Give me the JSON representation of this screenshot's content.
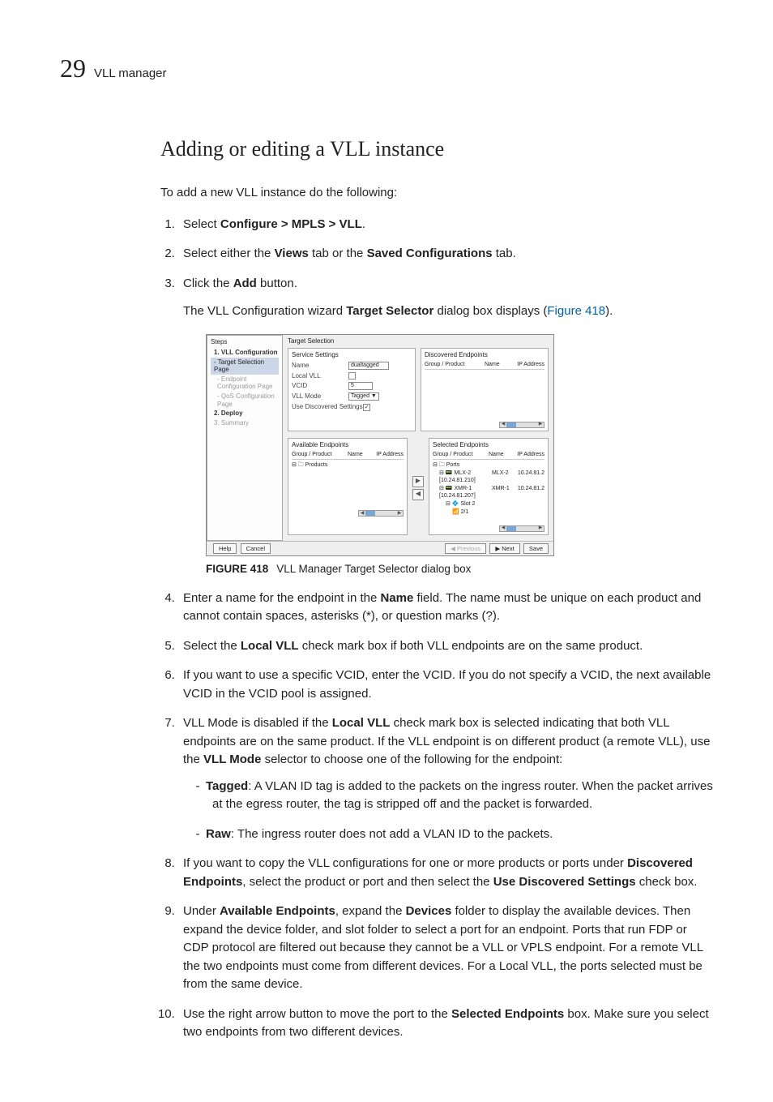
{
  "header": {
    "chapter_number": "29",
    "running_title": "VLL manager"
  },
  "section_title": "Adding or editing a VLL instance",
  "intro": "To add a new VLL instance do the following:",
  "steps": [
    {
      "pre": "Select ",
      "b1": "Configure > MPLS > VLL",
      "post1": "."
    },
    {
      "pre": "Select either the ",
      "b1": "Views",
      "post1": " tab or the ",
      "b2": "Saved Configurations",
      "post2": " tab."
    },
    {
      "pre": "Click the ",
      "b1": "Add",
      "post1": " button."
    }
  ],
  "indent_after_3": {
    "pre": "The VLL Configuration wizard ",
    "b1": "Target Selector",
    "post1": " dialog box displays (",
    "figref": "Figure 418",
    "post2": ")."
  },
  "figure": {
    "label": "FIGURE 418",
    "caption": "VLL Manager Target Selector dialog box",
    "steps_title": "Steps",
    "steps_list": {
      "s1": "1. VLL Configuration",
      "s1a": "- Target Selection Page",
      "s1b": "- Endpoint Configuration Page",
      "s1c": "- QoS Configuration Page",
      "s2": "2. Deploy",
      "s3": "3. Summary"
    },
    "target_selection": "Target Selection",
    "svc_settings": "Service Settings",
    "name_label": "Name",
    "name_value": "dualtagged",
    "localvll_label": "Local VLL",
    "vcid_label": "VCID",
    "vcid_value": "5",
    "vllmode_label": "VLL Mode",
    "vllmode_value": "Tagged ▼",
    "use_disc_label": "Use Discovered Settings",
    "chk_checked": "✓",
    "discovered": "Discovered Endpoints",
    "available": "Available Endpoints",
    "selected": "Selected Endpoints",
    "col_group": "Group / Product",
    "col_name": "Name",
    "col_ip": "IP Address",
    "avail_row1": "⊟ 🗀 Products",
    "sel_row1": "⊟ 🗀 Ports",
    "sel_row2_g": "⊟ 📟 MLX-2 [10.24.81.210]",
    "sel_row2_n": "MLX-2",
    "sel_row2_ip": "10.24.81.2",
    "sel_row3_g": "⊟ 📟 XMR-1 [10.24.81.207]",
    "sel_row3_n": "XMR-1",
    "sel_row3_ip": "10.24.81.2",
    "sel_row4": "⊟ 💠 Slot 2",
    "sel_row5": "📶 2/1",
    "btn_help": "Help",
    "btn_cancel": "Cancel",
    "btn_prev": "◀ Previous",
    "btn_next": "▶ Next",
    "btn_save": "Save"
  },
  "step4": {
    "pre": "Enter a name for the endpoint in the ",
    "b1": "Name",
    "post1": " field. The name must be unique on each product and cannot contain spaces, asterisks (*), or question marks (?)."
  },
  "step5": {
    "pre": "Select the ",
    "b1": "Local VLL",
    "post1": " check mark box if both VLL endpoints are on the same product."
  },
  "step6": "If you want to use a specific VCID, enter the VCID. If you do not specify a VCID, the next available VCID in the VCID pool is assigned.",
  "step7": {
    "pre": "VLL Mode is disabled if the ",
    "b1": "Local VLL",
    "mid1": " check mark box is selected indicating that both VLL endpoints are on the same product. If the VLL endpoint is on different product (a remote VLL), use the ",
    "b2": "VLL Mode",
    "post2": " selector to choose one of the following for the endpoint:",
    "sub": [
      {
        "b": "Tagged",
        "t": ": A VLAN ID tag is added to the packets on the ingress router. When the packet arrives at the egress router, the tag is stripped off and the packet is forwarded."
      },
      {
        "b": "Raw",
        "t": ": The ingress router does not add a VLAN ID to the packets."
      }
    ]
  },
  "step8": {
    "pre": "If you want to copy the VLL configurations for one or more products or ports under ",
    "b1": "Discovered Endpoints",
    "mid1": ", select the product or port and then select the ",
    "b2": "Use Discovered Settings",
    "post2": " check box."
  },
  "step9": {
    "pre": "Under ",
    "b1": "Available Endpoints",
    "mid1": ", expand the ",
    "b2": "Devices",
    "post2": " folder to display the available devices. Then expand the device folder, and slot folder to select a port for an endpoint. Ports that run FDP or CDP protocol are filtered out because they cannot be a VLL or VPLS endpoint. For a remote VLL the two endpoints must come from different devices. For a Local VLL, the ports selected must be from the same device."
  },
  "step10": {
    "pre": "Use the right arrow button to move the port to the ",
    "b1": "Selected Endpoints",
    "post1": " box. Make sure you select two endpoints from two different devices."
  }
}
